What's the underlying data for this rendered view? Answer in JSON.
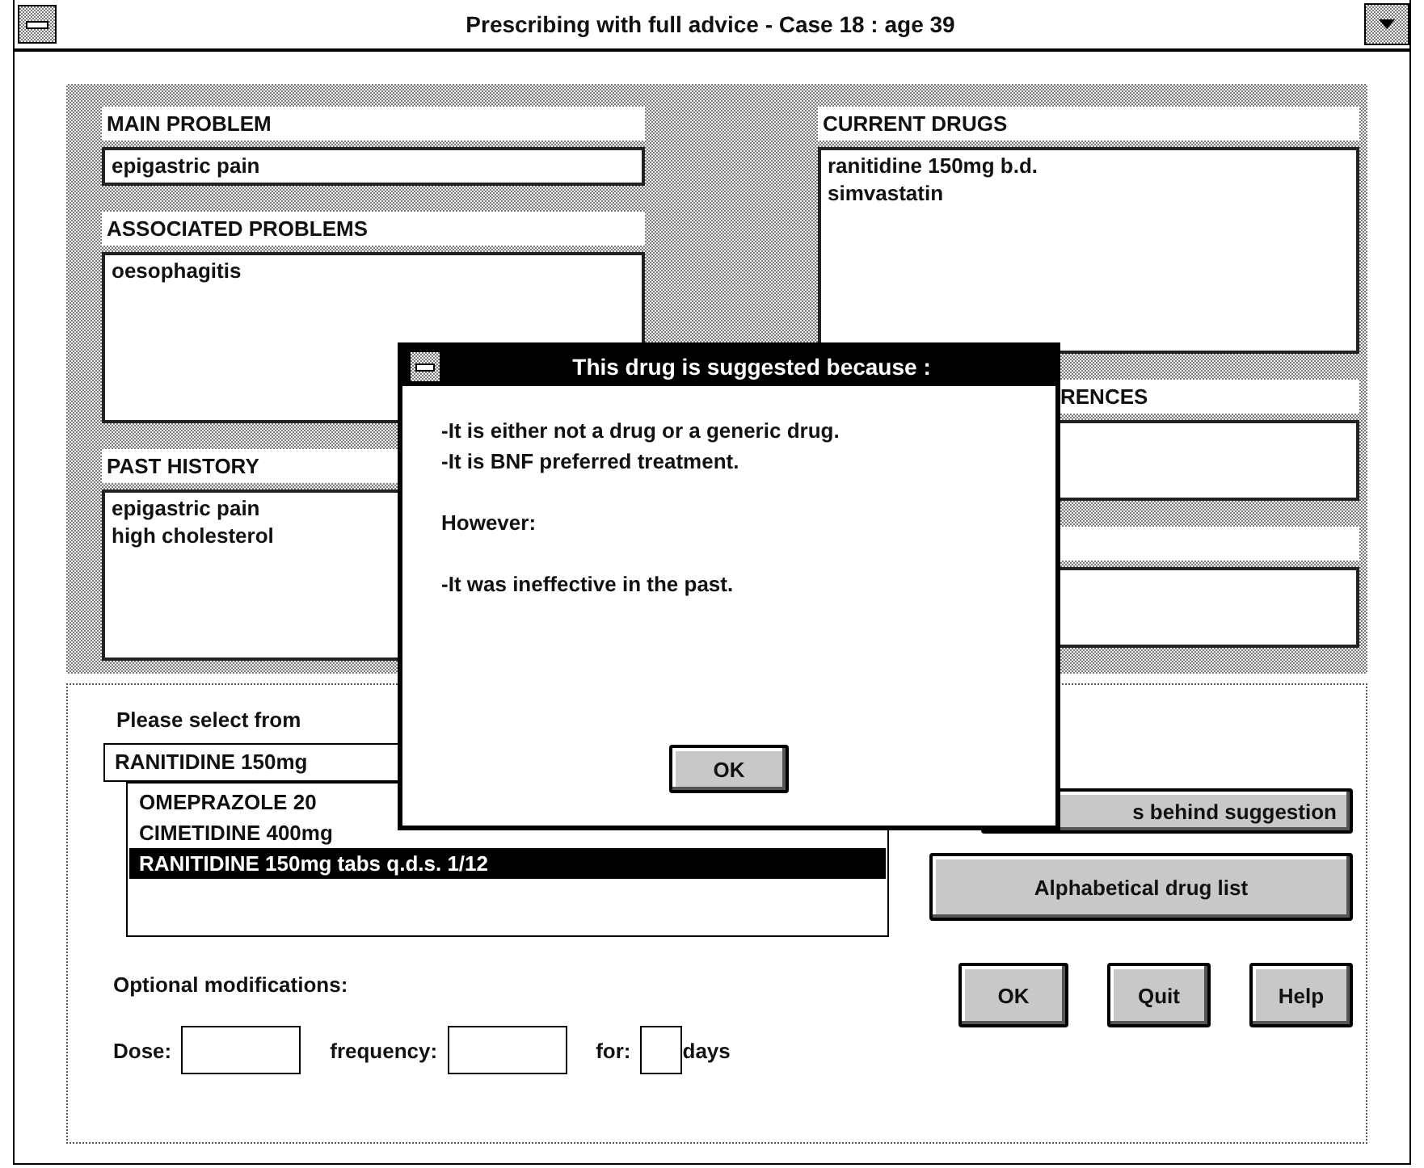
{
  "window": {
    "title": "Prescribing with full advice - Case 18 :  age 39"
  },
  "left": [
    {
      "label": "MAIN PROBLEM",
      "kind": "single",
      "lines": [
        "epigastric pain"
      ]
    },
    {
      "label": "ASSOCIATED PROBLEMS",
      "kind": "multi",
      "lines": [
        "oesophagitis"
      ]
    },
    {
      "label": "PAST HISTORY",
      "kind": "multi",
      "lines": [
        "epigastric pain",
        "high cholesterol"
      ]
    }
  ],
  "right": [
    {
      "label": "CURRENT DRUGS",
      "kind": "tall",
      "lines": [
        "ranitidine 150mg b.d.",
        "simvastatin"
      ]
    },
    {
      "label": "RENCES",
      "kind": "short"
    },
    {
      "kind": "short"
    }
  ],
  "selection": {
    "prompt": "Please select from",
    "combo_value": "RANITIDINE 150mg",
    "options": [
      {
        "label": "OMEPRAZOLE 20",
        "selected": false
      },
      {
        "label": "CIMETIDINE 400mg",
        "selected": false
      },
      {
        "label": "RANITIDINE 150mg tabs q.d.s. 1/12",
        "selected": true
      }
    ]
  },
  "side_buttons": [
    "s behind suggestion",
    "Alphabetical drug list"
  ],
  "modifications": {
    "title": "Optional modifications:",
    "fields": [
      {
        "label": "Dose:"
      },
      {
        "label": "frequency:"
      },
      {
        "label": "for:",
        "suffix": "days"
      }
    ]
  },
  "buttons": [
    "OK",
    "Quit",
    "Help"
  ],
  "dialog": {
    "title": "This drug is suggested because :",
    "paragraphs": [
      {
        "lines": [
          "-It is either not a drug or a generic drug.",
          "-It is BNF preferred treatment."
        ]
      },
      {
        "lines": [
          "However:"
        ]
      },
      {
        "lines": [
          "-It was ineffective in the past."
        ]
      }
    ],
    "button": "OK"
  }
}
